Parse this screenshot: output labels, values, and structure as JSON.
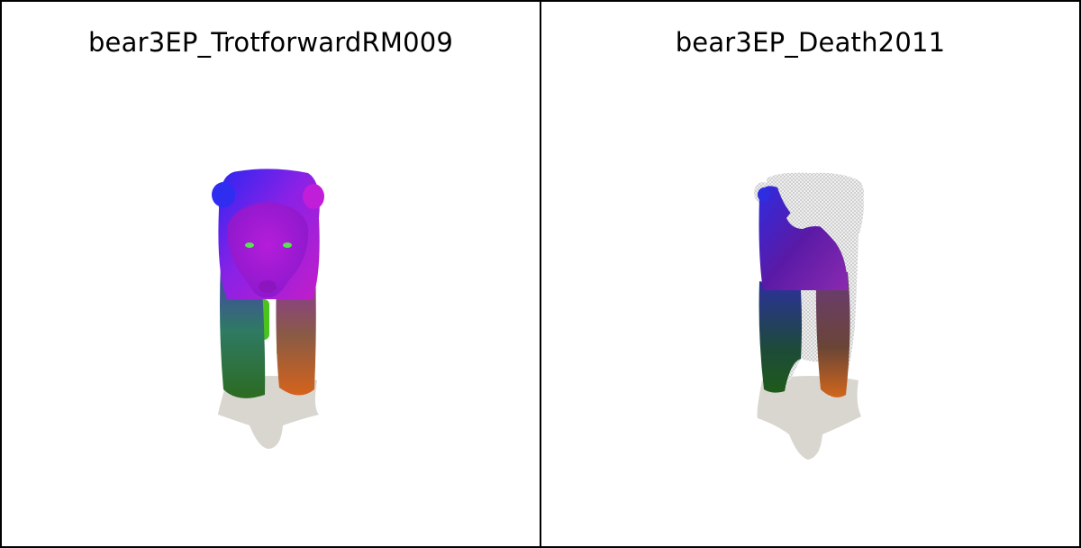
{
  "panels": [
    {
      "title": "bear3EP_TrotforwardRM009"
    },
    {
      "title": "bear3EP_Death2011"
    }
  ],
  "colors": {
    "border": "#000000",
    "background": "#ffffff",
    "shadow": "#d9d6cf",
    "wireframe": "#e4e4e4"
  }
}
